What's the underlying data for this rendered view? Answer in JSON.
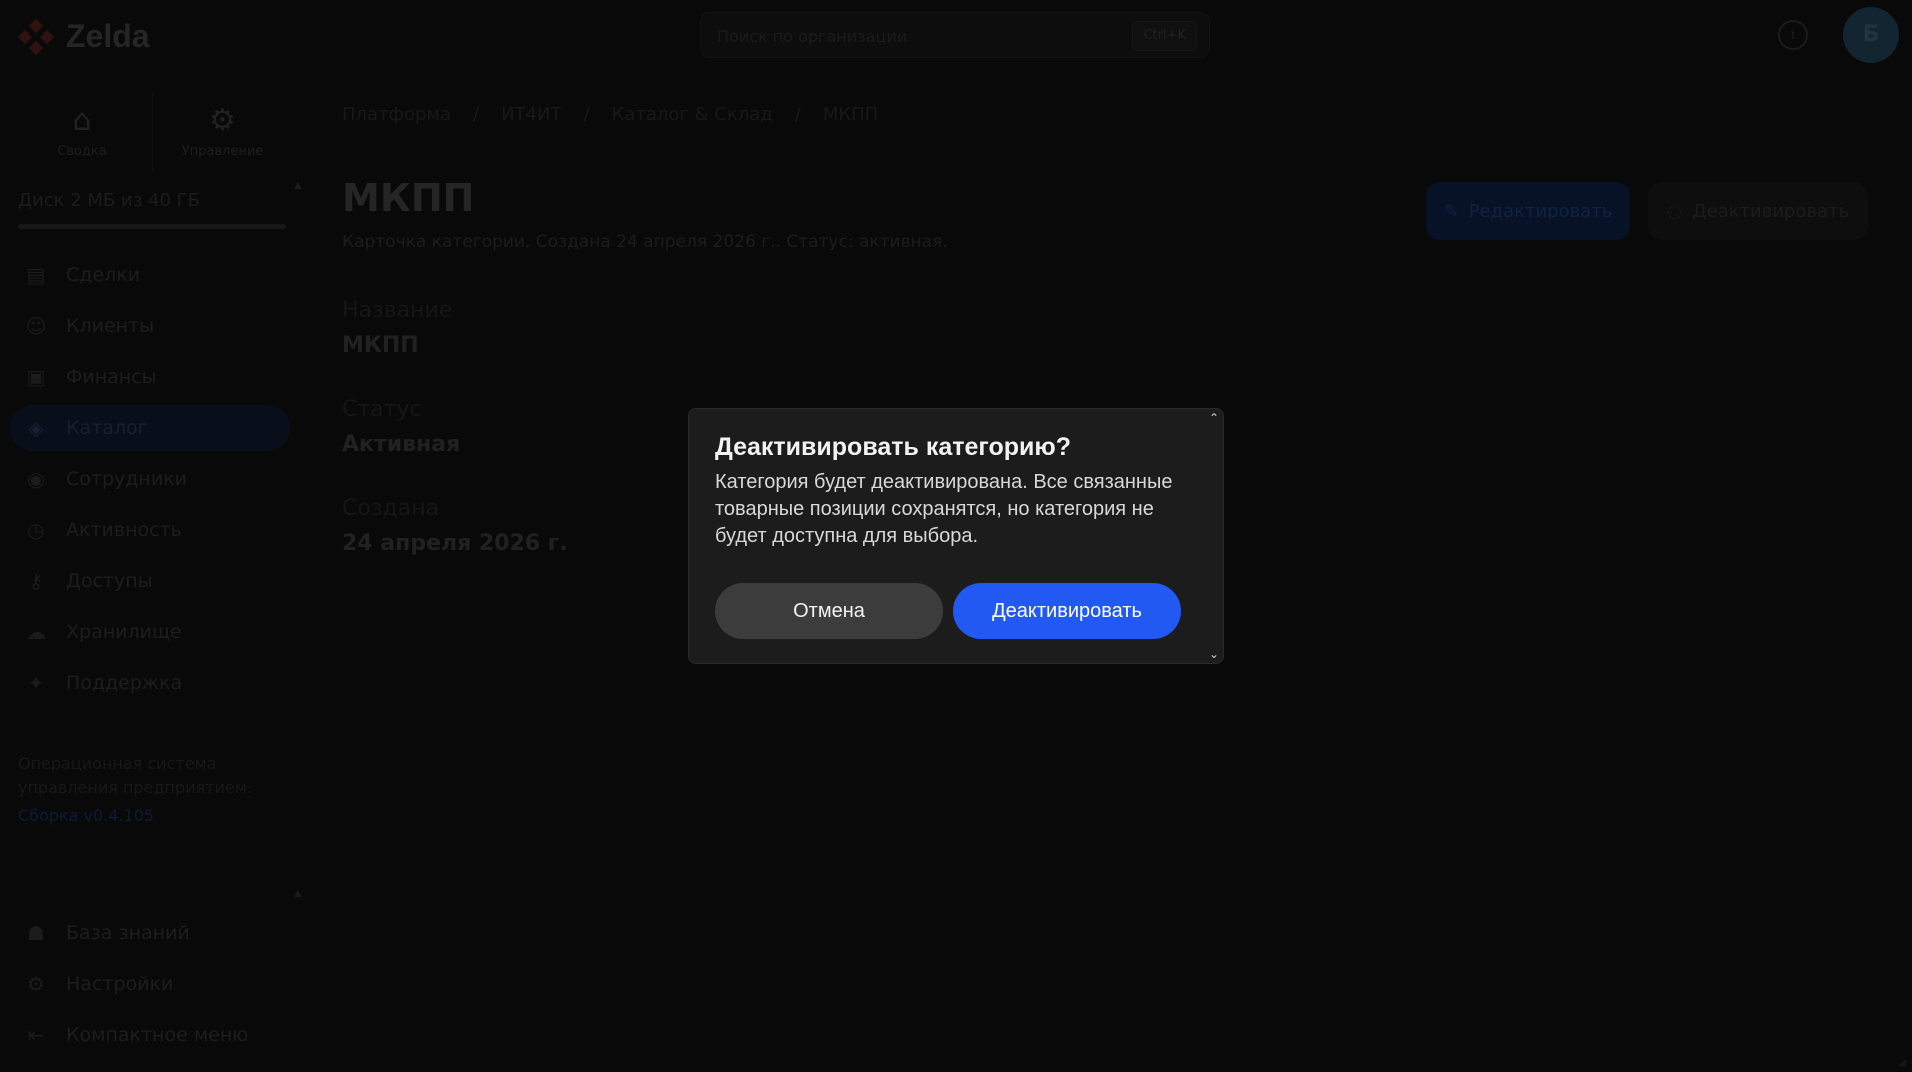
{
  "app": {
    "logo_text": "Zelda",
    "brand_color": "#c0392b"
  },
  "header": {
    "search_placeholder": "Поиск по организации",
    "search_shortcut": "Ctrl+K",
    "info_icon": "i",
    "avatar_initial": "Б"
  },
  "sidebar": {
    "modes": [
      {
        "label": "Сводка",
        "icon": "home-icon"
      },
      {
        "label": "Управление",
        "icon": "gear-icon"
      }
    ],
    "disk_usage": "Диск 2 МБ из 40 ГБ",
    "items": [
      {
        "label": "Сделки",
        "icon": "deals-icon",
        "active": false
      },
      {
        "label": "Клиенты",
        "icon": "clients-icon",
        "active": false
      },
      {
        "label": "Финансы",
        "icon": "finance-icon",
        "active": false
      },
      {
        "label": "Каталог",
        "icon": "catalog-icon",
        "active": true
      },
      {
        "label": "Сотрудники",
        "icon": "staff-icon",
        "active": false
      },
      {
        "label": "Активность",
        "icon": "activity-icon",
        "active": false
      },
      {
        "label": "Доступы",
        "icon": "access-icon",
        "active": false
      },
      {
        "label": "Хранилище",
        "icon": "storage-icon",
        "active": false
      },
      {
        "label": "Поддержка",
        "icon": "support-icon",
        "active": false
      }
    ],
    "footer_text": "Операционная система управления предприятием.",
    "build": "Сборка v0.4.105",
    "bottom_items": [
      {
        "label": "База знаний",
        "icon": "knowledge-icon"
      },
      {
        "label": "Настройки",
        "icon": "settings-icon"
      },
      {
        "label": "Компактное меню",
        "icon": "compact-menu-icon"
      }
    ]
  },
  "main": {
    "breadcrumb": [
      "Платформа",
      "/",
      "ИТ4ИТ",
      "/",
      "Каталог & Склад",
      "/",
      "МКПП"
    ],
    "title": "МКПП",
    "subtitle": "Карточка категории. Создана 24 апреля 2026 г.. Статус: активная.",
    "edit_button": "Редактировать",
    "deactivate_button": "Деактивировать",
    "fields": [
      {
        "label": "Название",
        "value": "МКПП"
      },
      {
        "label": "Статус",
        "value": "Активная"
      },
      {
        "label": "Создана",
        "value": "24 апреля 2026 г."
      }
    ]
  },
  "modal": {
    "title": "Деактивировать категорию?",
    "text": "Категория будет деактивирована. Все связанные товарные позиции сохранятся, но категория не будет доступна для выбора.",
    "cancel_label": "Отмена",
    "confirm_label": "Деактивировать",
    "confirm_color": "#2259f2"
  }
}
